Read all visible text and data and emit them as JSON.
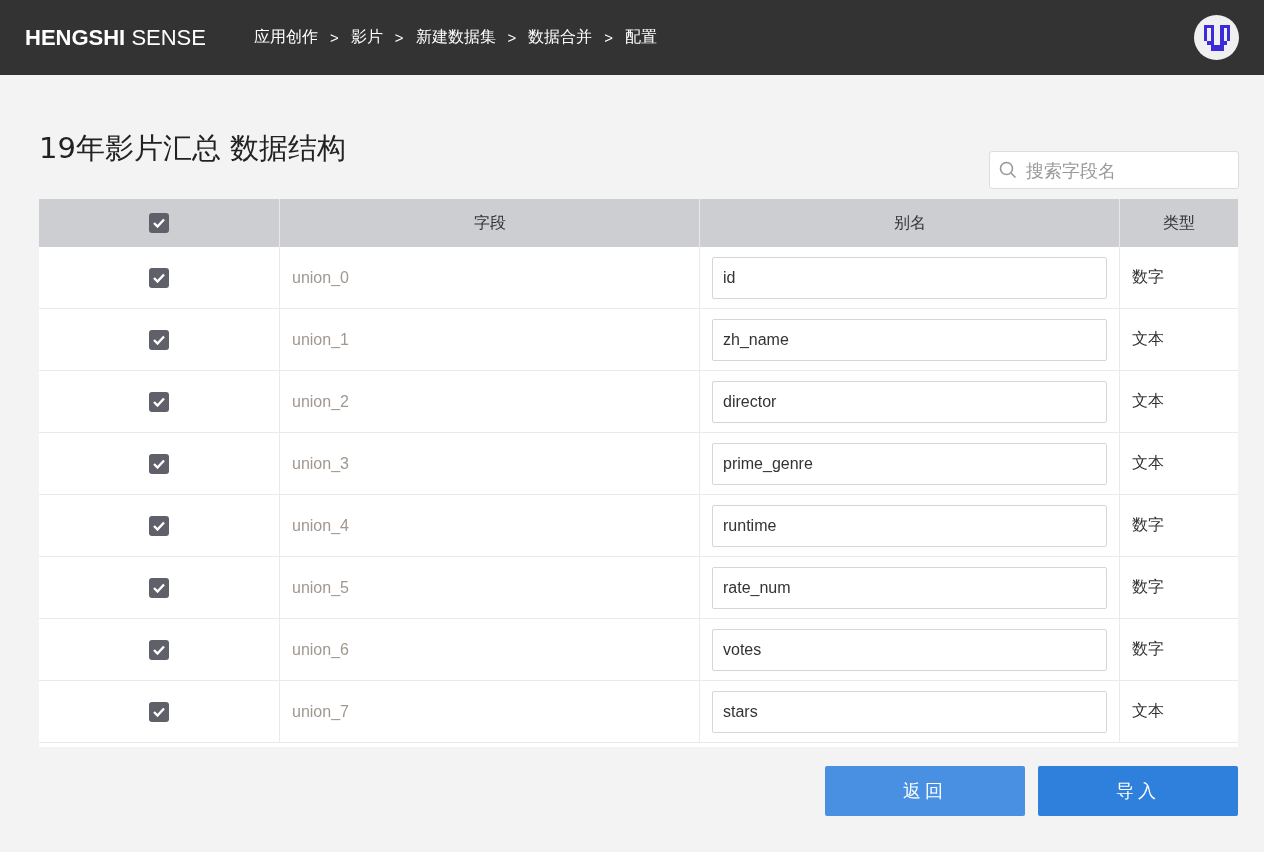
{
  "header": {
    "brand_bold": "HENGSHI",
    "brand_light": "SENSE",
    "breadcrumbs": [
      "应用创作",
      "影片",
      "新建数据集",
      "数据合并",
      "配置"
    ],
    "separator": ">"
  },
  "title": "19年影片汇总 数据结构",
  "search": {
    "placeholder": "搜索字段名"
  },
  "table": {
    "all_checked": true,
    "columns": [
      "字段",
      "别名",
      "类型"
    ],
    "rows": [
      {
        "checked": true,
        "field": "union_0",
        "alias": "id",
        "type": "数字"
      },
      {
        "checked": true,
        "field": "union_1",
        "alias": "zh_name",
        "type": "文本"
      },
      {
        "checked": true,
        "field": "union_2",
        "alias": "director",
        "type": "文本"
      },
      {
        "checked": true,
        "field": "union_3",
        "alias": "prime_genre",
        "type": "文本"
      },
      {
        "checked": true,
        "field": "union_4",
        "alias": "runtime",
        "type": "数字"
      },
      {
        "checked": true,
        "field": "union_5",
        "alias": "rate_num",
        "type": "数字"
      },
      {
        "checked": true,
        "field": "union_6",
        "alias": "votes",
        "type": "数字"
      },
      {
        "checked": true,
        "field": "union_7",
        "alias": "stars",
        "type": "文本"
      }
    ]
  },
  "buttons": [
    {
      "label": "返回",
      "kind": "secondary"
    },
    {
      "label": "导入",
      "kind": "primary"
    }
  ]
}
